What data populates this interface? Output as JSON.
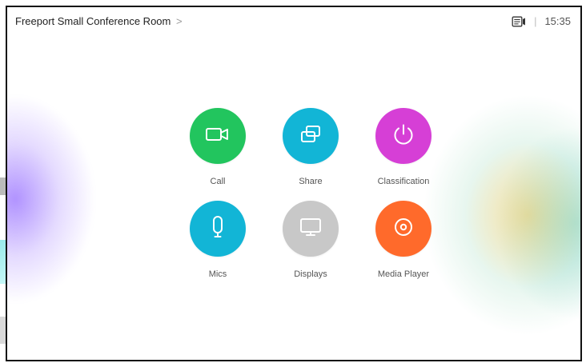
{
  "header": {
    "room_name": "Freeport Small Conference Room",
    "chevron": ">",
    "separator": "|",
    "time": "15:35",
    "status_icon": "screen-self-view-icon"
  },
  "tiles": [
    {
      "label": "Call",
      "icon": "video-camera-icon",
      "color": "#22c55e"
    },
    {
      "label": "Share",
      "icon": "share-screens-icon",
      "color": "#12b5d6"
    },
    {
      "label": "Classification",
      "icon": "power-icon",
      "color": "#d63fd6"
    },
    {
      "label": "Mics",
      "icon": "microphone-icon",
      "color": "#12b5d6"
    },
    {
      "label": "Displays",
      "icon": "monitor-icon",
      "color": "#c8c8c8"
    },
    {
      "label": "Media Player",
      "icon": "media-disc-icon",
      "color": "#ff6a2b"
    }
  ]
}
